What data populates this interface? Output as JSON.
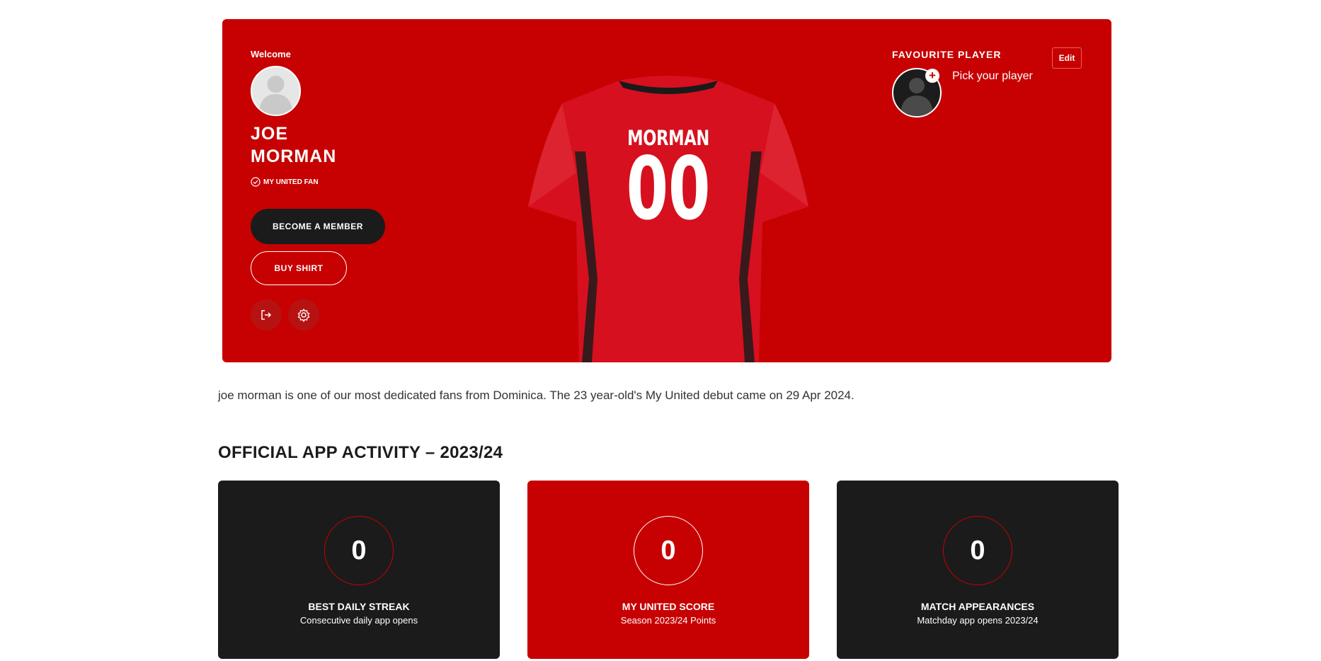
{
  "hero": {
    "welcome": "Welcome",
    "first_name": "JOE",
    "last_name": "MORMAN",
    "fan_badge": "MY UNITED FAN",
    "member_button": "BECOME A MEMBER",
    "shirt_button": "BUY SHIRT",
    "shirt_name": "MORMAN",
    "shirt_number": "00",
    "favourite_title": "FAVOURITE PLAYER",
    "favourite_pick": "Pick your player",
    "edit_label": "Edit"
  },
  "bio": "joe morman is one of our most dedicated fans from Dominica. The 23 year-old's My United debut came on 29 Apr 2024.",
  "activity": {
    "title": "OFFICIAL APP ACTIVITY – 2023/24",
    "stats": [
      {
        "value": "0",
        "label": "BEST DAILY STREAK",
        "sub": "Consecutive daily app opens"
      },
      {
        "value": "0",
        "label": "MY UNITED SCORE",
        "sub": "Season 2023/24 Points"
      },
      {
        "value": "0",
        "label": "MATCH APPEARANCES",
        "sub": "Matchday app opens 2023/24"
      }
    ]
  },
  "colors": {
    "brand_red": "#c70101",
    "dark": "#1b1b1b"
  }
}
